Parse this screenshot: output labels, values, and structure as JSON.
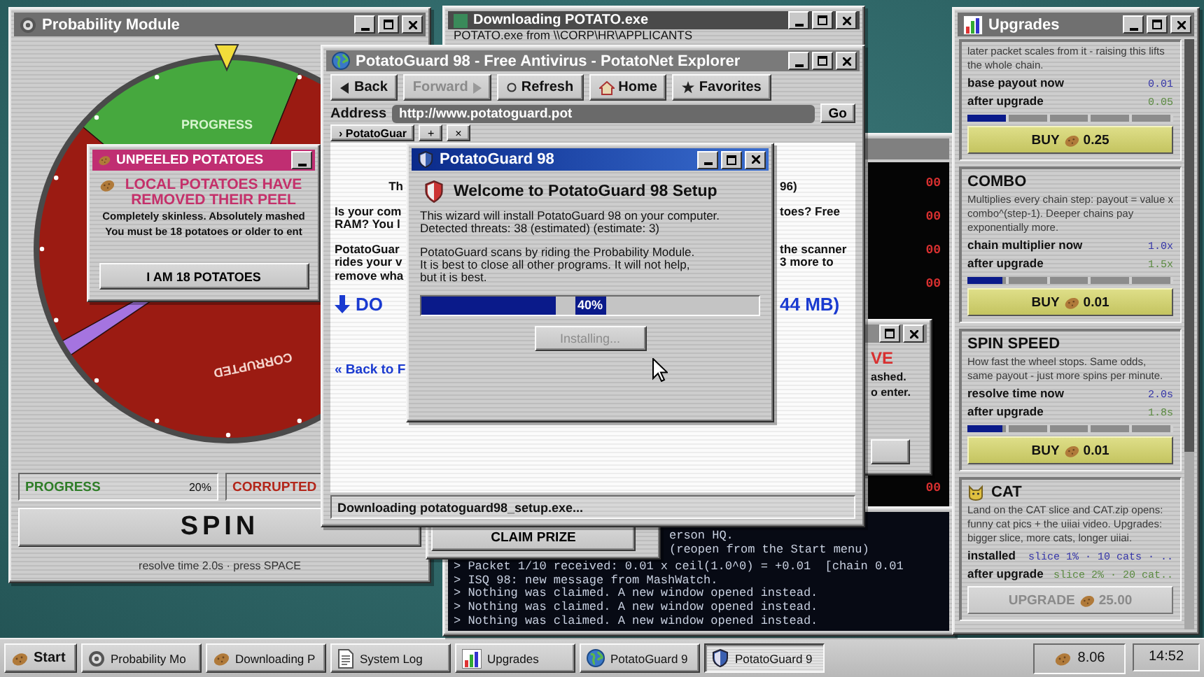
{
  "probability_module": {
    "title": "Probability Module",
    "wheel": {
      "slices": [
        {
          "label": "PROGRESS",
          "color": "#46a83e"
        },
        {
          "label": "CORRUPTED",
          "color": "#9b1b12"
        },
        {
          "color": "#a574e0"
        },
        {
          "color": "#9b1b12"
        }
      ]
    },
    "stats": [
      {
        "label": "PROGRESS",
        "value": "20%",
        "color": "#2f7d28"
      },
      {
        "label": "CORRUPTED",
        "color": "#b3261a"
      }
    ],
    "spin_button": "SPIN",
    "hint": "resolve time 2.0s · press SPACE"
  },
  "unpeeled_popup": {
    "title": "UNPEELED POTATOES",
    "headline": "LOCAL POTATOES HAVE REMOVED THEIR PEEL",
    "lines": [
      "Completely skinless. Absolutely mashed",
      "You must be 18 potatoes or older to ent"
    ],
    "button": "I AM 18 POTATOES"
  },
  "download_window": {
    "title": "Downloading POTATO.exe",
    "line": "POTATO.exe from \\\\CORP\\HR\\APPLICANTS"
  },
  "log_window": {
    "lines": [
      "00",
      "00",
      "00",
      "00",
      "00"
    ]
  },
  "side_popup": {
    "headline": "VE",
    "lines": [
      "ashed.",
      "o enter."
    ]
  },
  "claim_window": {
    "button": "CLAIM PRIZE"
  },
  "terminal": {
    "lines": [
      {
        "kind": "tail",
        "text": "erson HQ."
      },
      {
        "kind": "tail",
        "text": "(reopen from the Start menu)"
      },
      {
        "kind": "full",
        "text": "> Packet 1/10 received: 0.01 x ceil(1.0^0) = +0.01  [chain 0.01"
      },
      {
        "kind": "full",
        "text": "> ISQ 98: new message from MashWatch."
      },
      {
        "kind": "full",
        "text": "> Nothing was claimed. A new window opened instead."
      },
      {
        "kind": "full",
        "text": "> Nothing was claimed. A new window opened instead."
      },
      {
        "kind": "full",
        "text": "> Nothing was claimed. A new window opened instead."
      }
    ]
  },
  "browser": {
    "title": "PotatoGuard 98 - Free Antivirus - PotatoNet Explorer",
    "toolbar": [
      {
        "label": "Back",
        "disabled": false
      },
      {
        "label": "Forward",
        "disabled": true
      },
      {
        "label": "Refresh",
        "disabled": false
      },
      {
        "label": "Home",
        "disabled": false
      },
      {
        "label": "Favorites",
        "disabled": false
      }
    ],
    "address_label": "Address",
    "address": "http://www.potatoguard.pot",
    "go_button": "Go",
    "tabs": [
      {
        "label": "› PotatoGuar",
        "selected": true
      }
    ],
    "new_tab": "+",
    "close_tab": "×",
    "page": [
      {
        "kind": "heading",
        "left": [
          "Th"
        ],
        "right": [
          "96)"
        ]
      },
      {
        "kind": "text",
        "left": [
          "Is your com",
          "RAM? You l"
        ],
        "right": [
          "toes? Free"
        ]
      },
      {
        "kind": "text",
        "left": [
          "PotatoGuar",
          "rides your v",
          "remove wha"
        ],
        "right": [
          "the scanner",
          "3 more to"
        ]
      },
      {
        "kind": "download",
        "left": [
          "DO"
        ],
        "right": [
          "44 MB)"
        ]
      },
      {
        "kind": "link",
        "left": [
          "« Back to F"
        ]
      }
    ],
    "status": "Downloading potatoguard98_setup.exe..."
  },
  "wizard": {
    "title": "PotatoGuard 98",
    "heading": "Welcome to PotatoGuard 98 Setup",
    "paragraphs": [
      [
        "This wizard will install PotatoGuard 98 on your computer.",
        "Detected threats: 38 (estimated) (estimate: 3)"
      ],
      [
        "PotatoGuard scans by riding the Probability Module.",
        "It is best to close all other programs. It will not help,",
        "but it is best."
      ]
    ],
    "progress": {
      "level": 0.4,
      "label": "40%"
    },
    "button": {
      "label": "Installing...",
      "disabled": true
    }
  },
  "upgrades": {
    "title": "Upgrades",
    "cards": [
      {
        "kind": "level",
        "description": "later packet scales from it - raising this lifts the whole chain.",
        "rows": [
          {
            "label": "base payout now",
            "value": "0.01"
          },
          {
            "label": "after upgrade",
            "value": "0.05"
          }
        ],
        "level": 0.2,
        "button": {
          "label": "BUY",
          "price": "0.25",
          "disabled": false
        }
      },
      {
        "kind": "level",
        "title": "COMBO",
        "description": "Multiplies every chain step: payout = value x combo^(step-1). Deeper chains pay exponentially more.",
        "rows": [
          {
            "label": "chain multiplier now",
            "value": "1.0x"
          },
          {
            "label": "after upgrade",
            "value": "1.5x"
          }
        ],
        "level": 0.17,
        "button": {
          "label": "BUY",
          "price": "0.01",
          "disabled": false
        }
      },
      {
        "kind": "level",
        "title": "SPIN SPEED",
        "description": "How fast the wheel stops. Same odds, same payout - just more spins per minute.",
        "rows": [
          {
            "label": "resolve time now",
            "value": "2.0s"
          },
          {
            "label": "after upgrade",
            "value": "1.8s"
          }
        ],
        "level": 0.17,
        "button": {
          "label": "BUY",
          "price": "0.01",
          "disabled": false
        }
      },
      {
        "kind": "install",
        "title": "CAT",
        "description": "Land on the CAT slice and CAT.zip opens: funny cat pics + the uiiai video. Upgrades: bigger slice, more cats, longer uiiai.",
        "rows": [
          {
            "label": "installed",
            "value": "slice 1% · 10 cats · .."
          },
          {
            "label": "after upgrade",
            "value": "slice 2% · 20 cat.."
          }
        ],
        "button": {
          "label": "UPGRADE",
          "price": "25.00",
          "disabled": true
        }
      }
    ]
  },
  "taskbar": {
    "start": "Start",
    "items": [
      {
        "label": "Probability Mo",
        "selected": false
      },
      {
        "label": "Downloading P",
        "selected": false
      },
      {
        "label": "System Log",
        "selected": false
      },
      {
        "label": "Upgrades",
        "selected": false
      },
      {
        "label": "PotatoGuard 9",
        "selected": false
      },
      {
        "label": "PotatoGuard 9",
        "selected": true
      }
    ],
    "coins": "8.06",
    "clock": "14:52"
  }
}
